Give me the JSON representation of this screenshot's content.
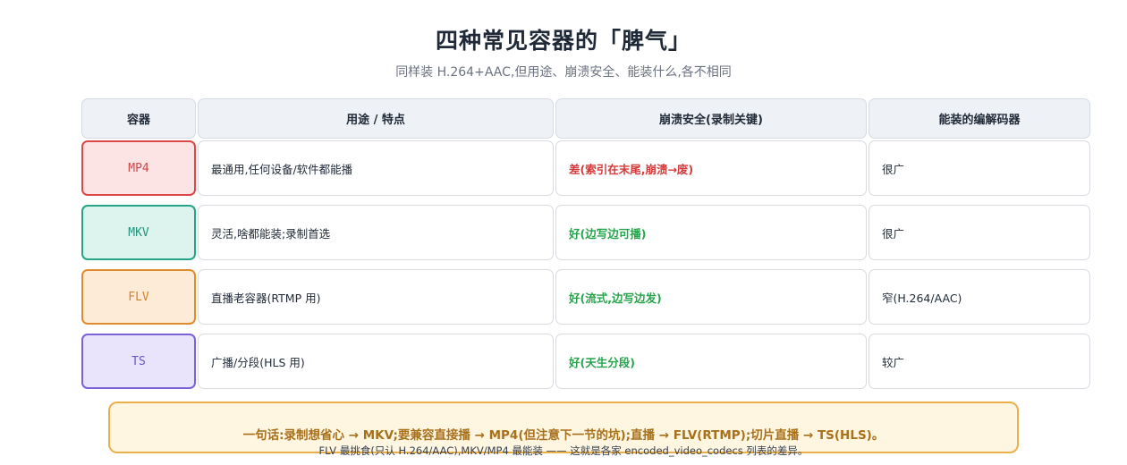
{
  "title": "四种常见容器的「脾气」",
  "subtitle": "同样装 H.264+AAC,但用途、崩溃安全、能装什么,各不相同",
  "table": {
    "headers": [
      "容器",
      "用途 / 特点",
      "崩溃安全(录制关键)",
      "能装的编解码器"
    ],
    "rows": [
      {
        "container": "MP4",
        "use": "最通用,任何设备/软件都能播",
        "safety": "差(索引在末尾,崩溃→废)",
        "safety_level": "bad",
        "codecs": "很广",
        "color": "#dc4848"
      },
      {
        "container": "MKV",
        "use": "灵活,啥都能装;录制首选",
        "safety": "好(边写边可播)",
        "safety_level": "good",
        "codecs": "很广",
        "color": "#27a38a"
      },
      {
        "container": "FLV",
        "use": "直播老容器(RTMP 用)",
        "safety": "好(流式,边写边发)",
        "safety_level": "good",
        "codecs": "窄(H.264/AAC)",
        "color": "#e08c2e"
      },
      {
        "container": "TS",
        "use": "广播/分段(HLS 用)",
        "safety": "好(天生分段)",
        "safety_level": "good",
        "codecs": "较广",
        "color": "#7b62d8"
      }
    ]
  },
  "note": {
    "main": "一句话:录制想省心 → MKV;要兼容直接播 → MP4(但注意下一节的坑);直播 → FLV(RTMP);切片直播 → TS(HLS)。",
    "sub": "FLV 最挑食(只认 H.264/AAC),MKV/MP4 最能装 —— 这就是各家 encoded_video_codecs 列表的差异。"
  }
}
